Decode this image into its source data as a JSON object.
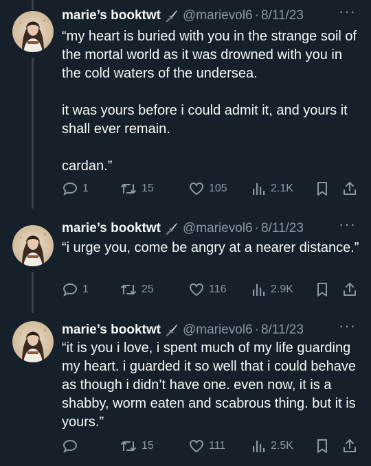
{
  "tweets": [
    {
      "name": "marie’s booktwt",
      "handle": "@marievol6",
      "separator": "·",
      "date": "8/11/23",
      "more": "···",
      "text": "“my heart is buried with you in the strange soil of the mortal world as it was drowned with you in the cold waters of the undersea.\n\nit was yours before i could admit it, and yours it shall ever remain.\n\ncardan.”",
      "replies": "1",
      "retweets": "15",
      "likes": "105",
      "views": "2.1K"
    },
    {
      "name": "marie’s booktwt",
      "handle": "@marievol6",
      "separator": "·",
      "date": "8/11/23",
      "more": "···",
      "text": "“i urge you, come be angry at a nearer distance.”",
      "replies": "1",
      "retweets": "25",
      "likes": "116",
      "views": "2.9K"
    },
    {
      "name": "marie’s booktwt",
      "handle": "@marievol6",
      "separator": "·",
      "date": "8/11/23",
      "more": "···",
      "text": "“it is you i love, i spent much of my life guarding my heart. i guarded it so well that i could behave as though i didn’t have one. even now, it is a shabby, worm eaten and scabrous thing. but it is yours.”",
      "replies": "",
      "retweets": "15",
      "likes": "111",
      "views": "2.5K"
    }
  ],
  "icons": {
    "reply": "reply-icon",
    "retweet": "retweet-icon",
    "like": "heart-icon",
    "views": "views-icon",
    "bookmark": "bookmark-icon",
    "share": "share-icon",
    "dagger": "dagger-icon"
  },
  "colors": {
    "background": "#15202b",
    "text": "#f7f9f9",
    "secondary": "#8b98a5",
    "thread_line": "#38444d"
  }
}
